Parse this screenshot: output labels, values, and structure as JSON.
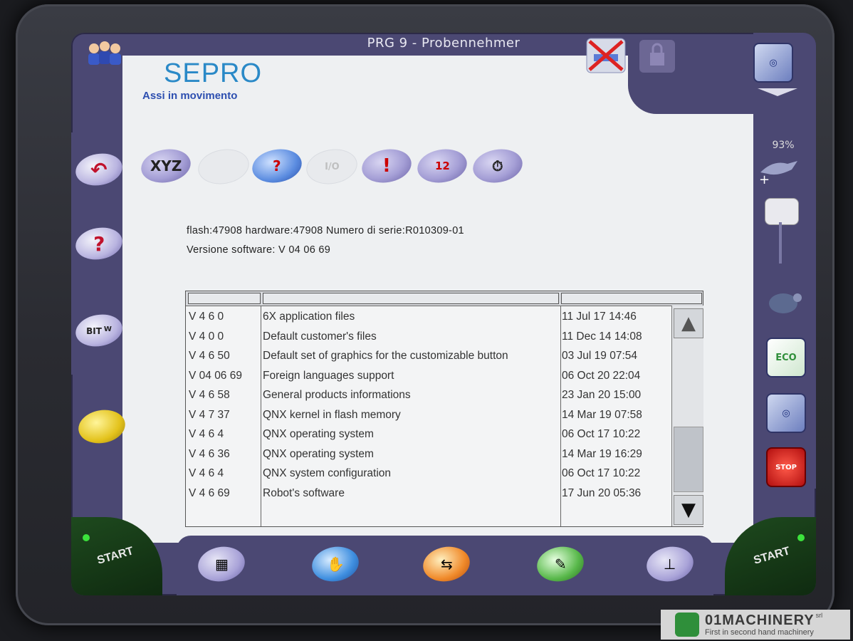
{
  "window": {
    "title": "PRG 9 - Probennehmer"
  },
  "branding": {
    "logo": "SEPRO",
    "subtitle": "Assi in movimento"
  },
  "toolbar": {
    "items": [
      {
        "icon": "axis-xyz-icon",
        "glyph": "XYZ"
      },
      {
        "icon": "io-diagram-icon",
        "glyph": ""
      },
      {
        "icon": "tools-question-icon",
        "glyph": "?"
      },
      {
        "icon": "io-disabled-icon",
        "glyph": "I/O"
      },
      {
        "icon": "alarm-icon",
        "glyph": "!"
      },
      {
        "icon": "calendar-icon",
        "glyph": "12"
      },
      {
        "icon": "clock-icon",
        "glyph": "⏱"
      }
    ]
  },
  "system": {
    "line1": "flash:47908 hardware:47908  Numero di serie:R010309-01",
    "line2": "Versione software: V 04 06 69"
  },
  "table": {
    "rows": [
      {
        "version": "V 4 6 0",
        "description": "6X application files",
        "date": "11 Jul 17 14:46"
      },
      {
        "version": "V 4 0 0",
        "description": "Default customer's files",
        "date": "11 Dec 14 14:08"
      },
      {
        "version": "V 4 6 50",
        "description": "Default set of graphics for the customizable button",
        "date": "03 Jul 19 07:54"
      },
      {
        "version": "V 04 06 69",
        "description": "Foreign languages support",
        "date": "06 Oct 20 22:04"
      },
      {
        "version": "V 4 6 58",
        "description": "General products informations",
        "date": "23 Jan 20 15:00"
      },
      {
        "version": "V 4 7 37",
        "description": "QNX kernel in flash memory",
        "date": "14 Mar 19 07:58"
      },
      {
        "version": "V 4 6 4",
        "description": "QNX operating system",
        "date": "06 Oct 17 10:22"
      },
      {
        "version": "V 4 6 36",
        "description": "QNX operating system",
        "date": "14 Mar 19 16:29"
      },
      {
        "version": "V 4 6 4",
        "description": "QNX system configuration",
        "date": "06 Oct 17 10:22"
      },
      {
        "version": "V 4 6 69",
        "description": "Robot's software",
        "date": "17 Jun 20 05:36"
      }
    ]
  },
  "left_buttons": {
    "back": "↶",
    "help": "?",
    "bit": "BIT",
    "w": "W"
  },
  "right_panel": {
    "zoom": "93%",
    "eco": "ECO",
    "stop": "STOP"
  },
  "start": {
    "left": "START",
    "right": "START"
  },
  "watermark": {
    "brand": "01MACHINERY",
    "srl": "srl",
    "tagline": "First in second hand machinery"
  }
}
